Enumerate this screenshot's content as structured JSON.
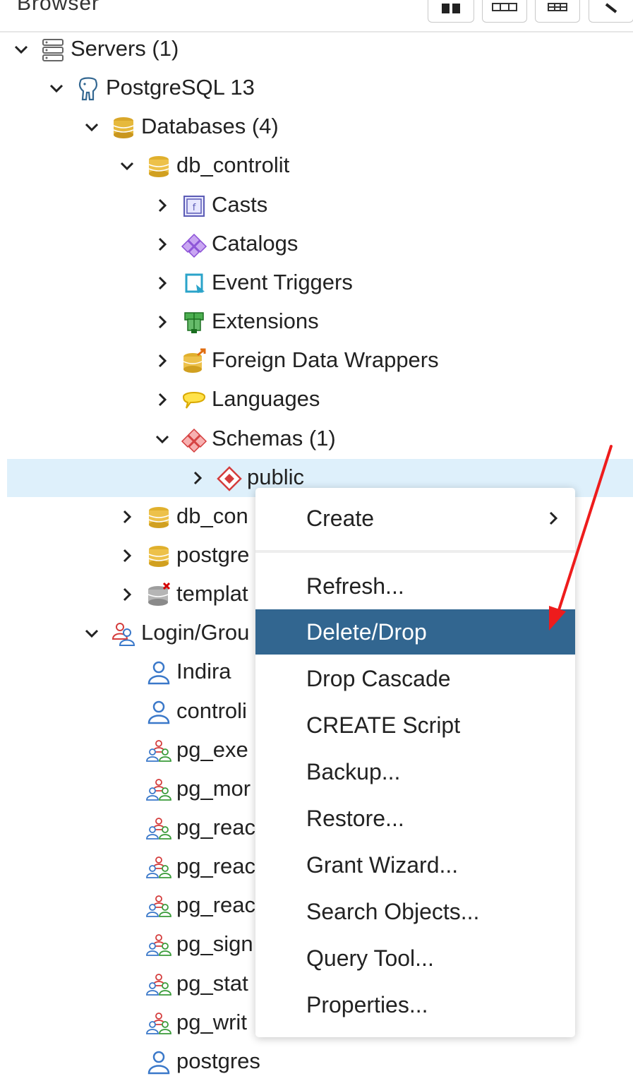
{
  "browser": {
    "title": "Browser"
  },
  "tree": [
    {
      "label": "Servers (1)",
      "icon": "servers-icon",
      "chevron": "down",
      "level": 0
    },
    {
      "label": "PostgreSQL 13",
      "icon": "postgresql-elephant-icon",
      "chevron": "down",
      "level": 1
    },
    {
      "label": "Databases (4)",
      "icon": "databases-icon",
      "chevron": "down",
      "level": 2
    },
    {
      "label": "db_controlit",
      "icon": "database-icon",
      "chevron": "down",
      "level": 3
    },
    {
      "label": "Casts",
      "icon": "casts-icon",
      "chevron": "right",
      "level": 4
    },
    {
      "label": "Catalogs",
      "icon": "catalogs-icon",
      "chevron": "right",
      "level": 4
    },
    {
      "label": "Event Triggers",
      "icon": "event-triggers-icon",
      "chevron": "right",
      "level": 4
    },
    {
      "label": "Extensions",
      "icon": "extensions-icon",
      "chevron": "right",
      "level": 4
    },
    {
      "label": "Foreign Data Wrappers",
      "icon": "foreign-data-wrappers-icon",
      "chevron": "right",
      "level": 4
    },
    {
      "label": "Languages",
      "icon": "languages-icon",
      "chevron": "right",
      "level": 4
    },
    {
      "label": "Schemas (1)",
      "icon": "schemas-icon",
      "chevron": "down",
      "level": 4
    },
    {
      "label": "public",
      "icon": "schema-public-icon",
      "chevron": "right",
      "level": 5,
      "selected": true
    },
    {
      "label": "db_con",
      "icon": "database-icon",
      "chevron": "right",
      "level": 3
    },
    {
      "label": "postgre",
      "icon": "database-icon",
      "chevron": "right",
      "level": 3
    },
    {
      "label": "templat",
      "icon": "database-disconnected-icon",
      "chevron": "right",
      "level": 3
    },
    {
      "label": "Login/Grou",
      "icon": "login-group-roles-icon",
      "chevron": "down",
      "level": 2
    },
    {
      "label": "Indira",
      "icon": "login-role-icon",
      "chevron": "none",
      "level": 3
    },
    {
      "label": "controli",
      "icon": "login-role-icon",
      "chevron": "none",
      "level": 3
    },
    {
      "label": "pg_exe",
      "icon": "group-role-icon",
      "chevron": "none",
      "level": 3
    },
    {
      "label": "pg_mor",
      "icon": "group-role-icon",
      "chevron": "none",
      "level": 3
    },
    {
      "label": "pg_reac",
      "icon": "group-role-icon",
      "chevron": "none",
      "level": 3
    },
    {
      "label": "pg_reac",
      "icon": "group-role-icon",
      "chevron": "none",
      "level": 3
    },
    {
      "label": "pg_reac",
      "icon": "group-role-icon",
      "chevron": "none",
      "level": 3
    },
    {
      "label": "pg_sign",
      "icon": "group-role-icon",
      "chevron": "none",
      "level": 3
    },
    {
      "label": "pg_stat",
      "icon": "group-role-icon",
      "chevron": "none",
      "level": 3
    },
    {
      "label": "pg_writ",
      "icon": "group-role-icon",
      "chevron": "none",
      "level": 3
    },
    {
      "label": "postgres",
      "icon": "login-role-icon",
      "chevron": "none",
      "level": 3
    }
  ],
  "context_menu": {
    "items": [
      {
        "label": "Create",
        "submenu": true
      },
      {
        "label": "Refresh..."
      },
      {
        "label": "Delete/Drop",
        "active": true
      },
      {
        "label": "Drop Cascade"
      },
      {
        "label": "CREATE Script"
      },
      {
        "label": "Backup..."
      },
      {
        "label": "Restore..."
      },
      {
        "label": "Grant Wizard..."
      },
      {
        "label": "Search Objects..."
      },
      {
        "label": "Query Tool..."
      },
      {
        "label": "Properties..."
      }
    ]
  },
  "colors": {
    "selected_row_bg": "#def0fb",
    "menu_active_bg": "#326690",
    "menu_active_text": "#ffffff",
    "annotation_arrow": "#ee1c1c"
  }
}
